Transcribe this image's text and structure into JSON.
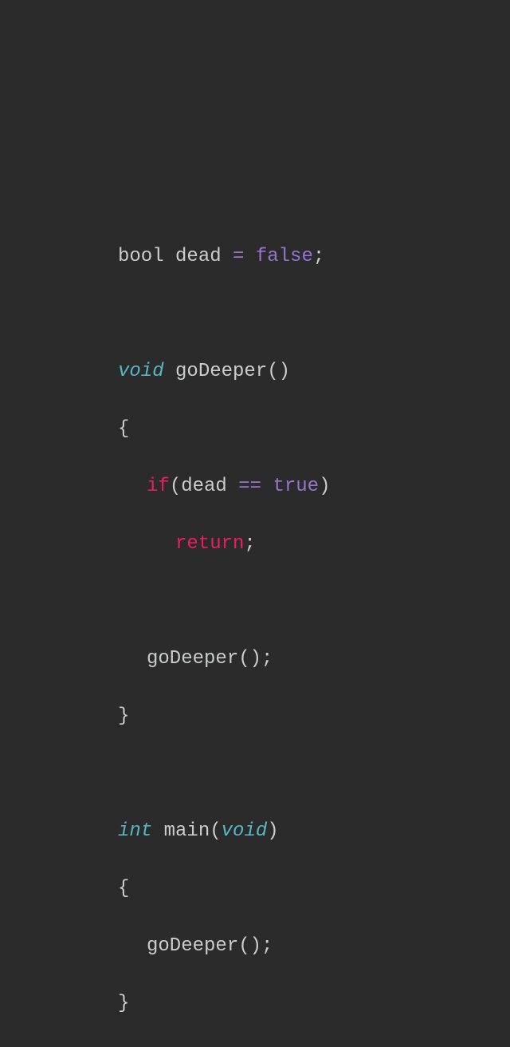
{
  "code": {
    "line1": {
      "type": "bool",
      "ident": "dead",
      "op": "=",
      "value": "false",
      "semi": ";"
    },
    "line3": {
      "type": "void",
      "func": "goDeeper",
      "parens": "()"
    },
    "line4": {
      "brace": "{"
    },
    "line5": {
      "kw": "if",
      "lparen": "(",
      "ident": "dead",
      "op": "==",
      "value": "true",
      "rparen": ")"
    },
    "line6": {
      "kw": "return",
      "semi": ";"
    },
    "line8": {
      "func": "goDeeper",
      "parens": "();"
    },
    "line9": {
      "brace": "}"
    },
    "line11": {
      "type": "int",
      "func": "main",
      "lparen": "(",
      "arg": "void",
      "rparen": ")"
    },
    "line12": {
      "brace": "{"
    },
    "line13": {
      "func": "goDeeper",
      "parens": "();"
    },
    "line14": {
      "brace": "}"
    }
  },
  "colors": {
    "background": "#2b2b2b",
    "text": "#cbcccc",
    "typeItalic": "#56b6c2",
    "constant": "#9575cd",
    "keyword": "#e91e63"
  }
}
